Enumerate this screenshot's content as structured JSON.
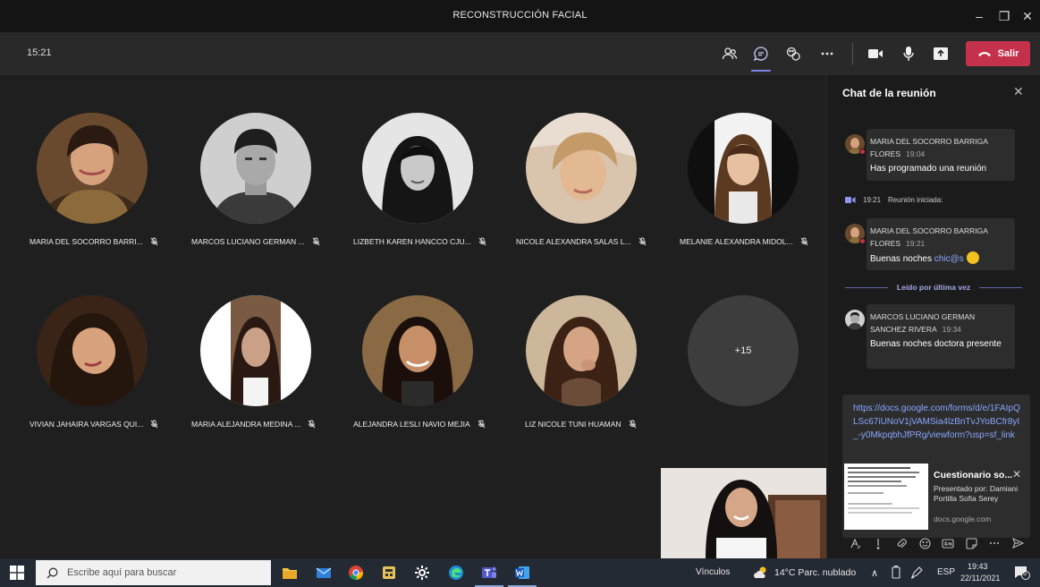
{
  "window": {
    "title": "RECONSTRUCCIÓN FACIAL",
    "minimize_glyph": "–",
    "maximize_glyph": "❐",
    "close_glyph": "✕"
  },
  "toolbar": {
    "elapsed_time": "15:21",
    "leave_label": "Salir",
    "icons": [
      "participants-icon",
      "chat-icon",
      "reactions-icon",
      "more-options-icon",
      "camera-icon",
      "microphone-icon",
      "share-screen-icon"
    ]
  },
  "participants": [
    {
      "name": "MARIA DEL SOCORRO BARRI...",
      "muted_icon": "mic-off-icon"
    },
    {
      "name": "MARCOS LUCIANO GERMAN ...",
      "muted_icon": "mic-off-icon"
    },
    {
      "name": "LIZBETH KAREN HANCCO CJU...",
      "muted_icon": "mic-off-icon"
    },
    {
      "name": "NICOLE ALEXANDRA SALAS L...",
      "muted_icon": "mic-off-icon"
    },
    {
      "name": "MELANIE ALEXANDRA MIDOL...",
      "muted_icon": "mic-off-icon"
    },
    {
      "name": "VIVIAN JAHAIRA VARGAS QUI...",
      "muted_icon": "mic-off-icon"
    },
    {
      "name": "MARIA ALEJANDRA MEDINA ...",
      "muted_icon": "mic-off-icon"
    },
    {
      "name": "ALEJANDRA LESLI NAVIO MEJIA",
      "muted_icon": "mic-off-icon"
    },
    {
      "name": "LIZ NICOLE TUNI HUAMAN",
      "muted_icon": "mic-off-icon"
    }
  ],
  "overflow_count": "+15",
  "chat": {
    "header": "Chat de la reunión",
    "messages": [
      {
        "author_line1": "MARIA DEL SOCORRO BARRIGA",
        "author_line2": "FLORES",
        "time": "19:04",
        "text": "Has programado una reunión"
      },
      {
        "author_line1": "MARIA DEL SOCORRO BARRIGA",
        "author_line2": "FLORES",
        "time": "19:21",
        "text": "Buenas noches ",
        "link": "chic@s"
      },
      {
        "author_line1": "MARCOS LUCIANO GERMAN",
        "author_line2": "SANCHEZ RIVERA",
        "time": "19:34",
        "text": "Buenas noches doctora presente"
      }
    ],
    "system_event": {
      "time": "19:21",
      "text": "Reunión iniciada:"
    },
    "read_divider": "Leído por última vez",
    "link_message": {
      "url": "https://docs.google.com/forms/d/e/1FAIpQLSc67iUNoV1jVAMSia4lzBnTvJYoBCfr8yI_-y0MkpqbhJfPRg/viewform?usp=sf_link",
      "preview_title": "Cuestionario so...",
      "preview_by": "Presentado por: Damiani Portilla Sofia Serey",
      "preview_domain": "docs.google.com"
    },
    "compose_icons": [
      "format-icon",
      "priority-icon",
      "attach-icon",
      "emoji-icon",
      "gif-icon",
      "sticker-icon",
      "more-icon",
      "send-icon"
    ]
  },
  "taskbar": {
    "search_placeholder": "Escribe aquí para buscar",
    "links_label": "Vínculos",
    "weather": "14°C Parc. nublado",
    "language": "ESP",
    "time": "19:43",
    "date": "22/11/2021",
    "notifications_count": "6"
  },
  "colors": {
    "accent": "#7b83eb",
    "leave": "#c4314b",
    "link": "#8aa6ff"
  }
}
